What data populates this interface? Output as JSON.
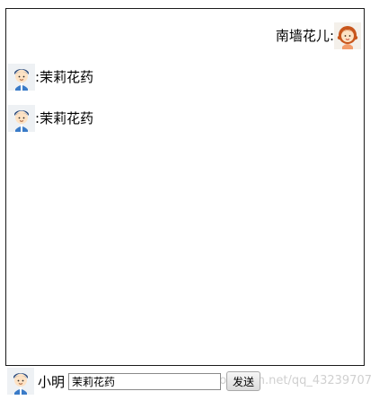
{
  "messages": [
    {
      "sender": "南墙花儿",
      "separator": ":",
      "align": "right",
      "avatar": "girl-avatar-icon"
    },
    {
      "sender": "",
      "separator": ":",
      "text": "茉莉花药",
      "align": "left",
      "avatar": "boy-avatar-icon"
    },
    {
      "sender": "",
      "separator": ":",
      "text": "茉莉花药",
      "align": "left",
      "avatar": "boy-avatar-icon"
    }
  ],
  "footer": {
    "user_avatar": "boy-avatar-icon",
    "user_name": "小明",
    "input_value": "茉莉花药",
    "send_label": "发送"
  },
  "watermark": "https://blog.csdn.net/qq_43239707",
  "colors": {
    "border": "#1a1a1a",
    "button_bg": "#e6e6e6",
    "watermark": "#d0d0d0"
  }
}
